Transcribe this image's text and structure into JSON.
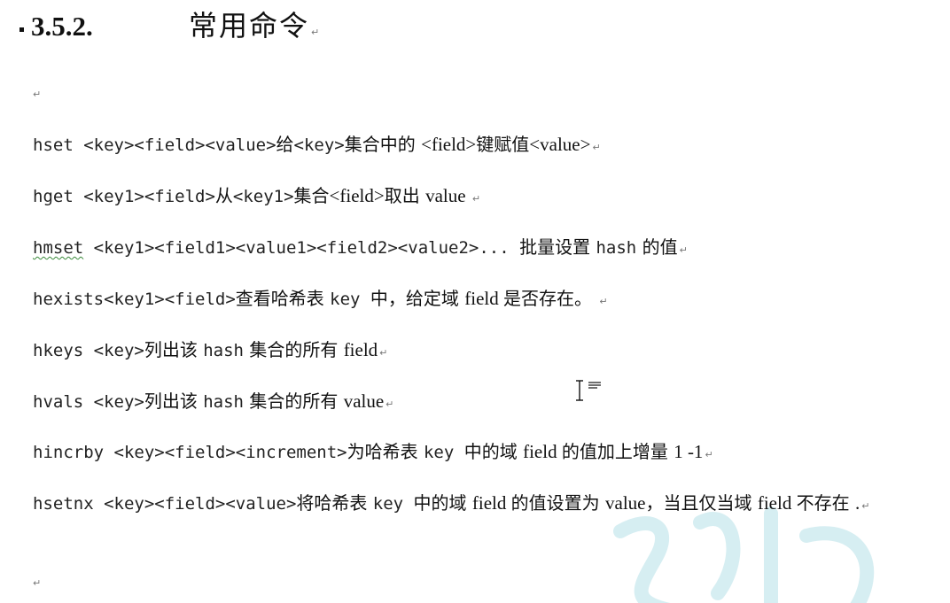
{
  "heading": {
    "number": "3.5.2.",
    "title": "常用命令"
  },
  "paragraph_mark": "↵",
  "commands": [
    {
      "id": "hset",
      "parts": [
        {
          "t": "hset <key><field><value>",
          "s": "mono"
        },
        {
          "t": "给",
          "s": "cjk"
        },
        {
          "t": "<key>",
          "s": "mono"
        },
        {
          "t": "集合中的 ",
          "s": "cjk"
        },
        {
          "t": "  <field>",
          "s": "serif"
        },
        {
          "t": "键赋值",
          "s": "cjk"
        },
        {
          "t": "<value>",
          "s": "serif"
        }
      ]
    },
    {
      "id": "hget",
      "parts": [
        {
          "t": "hget <key1><field>",
          "s": "mono"
        },
        {
          "t": "从",
          "s": "cjk"
        },
        {
          "t": "<key1>",
          "s": "mono"
        },
        {
          "t": "集合",
          "s": "cjk"
        },
        {
          "t": "<field>",
          "s": "serif"
        },
        {
          "t": "取出 ",
          "s": "cjk"
        },
        {
          "t": " value ",
          "s": "serif"
        }
      ]
    },
    {
      "id": "hmset",
      "parts": [
        {
          "t": "hmset",
          "s": "mono squiggle"
        },
        {
          "t": " <key1><field1><value1><field2><value2>... ",
          "s": "mono"
        },
        {
          "t": "批量设置 ",
          "s": "cjk"
        },
        {
          "t": "hash",
          "s": "mono"
        },
        {
          "t": " 的值",
          "s": "cjk"
        }
      ]
    },
    {
      "id": "hexists",
      "parts": [
        {
          "t": "hexists<key1><field>",
          "s": "mono"
        },
        {
          "t": "查看哈希表 ",
          "s": "cjk"
        },
        {
          "t": " key ",
          "s": "mono"
        },
        {
          "t": "中，给定域 ",
          "s": "cjk"
        },
        {
          "t": " field ",
          "s": "serif"
        },
        {
          "t": "是否存在。 ",
          "s": "cjk"
        }
      ]
    },
    {
      "id": "hkeys",
      "parts": [
        {
          "t": "hkeys <key>",
          "s": "mono"
        },
        {
          "t": "列出该 ",
          "s": "cjk"
        },
        {
          "t": "hash",
          "s": "mono"
        },
        {
          "t": " 集合的所有 ",
          "s": "cjk"
        },
        {
          "t": "field",
          "s": "serif"
        }
      ]
    },
    {
      "id": "hvals",
      "parts": [
        {
          "t": "hvals <key>",
          "s": "mono"
        },
        {
          "t": "列出该 ",
          "s": "cjk"
        },
        {
          "t": "hash",
          "s": "mono"
        },
        {
          "t": " 集合的所有 ",
          "s": "cjk"
        },
        {
          "t": "value",
          "s": "serif"
        }
      ]
    },
    {
      "id": "hincrby",
      "parts": [
        {
          "t": "hincrby <key><field><increment>",
          "s": "mono"
        },
        {
          "t": "为哈希表 ",
          "s": "cjk"
        },
        {
          "t": " key ",
          "s": "mono"
        },
        {
          "t": "中的域 ",
          "s": "cjk"
        },
        {
          "t": " field ",
          "s": "serif"
        },
        {
          "t": "的值加上增量 ",
          "s": "cjk"
        },
        {
          "t": " 1  -1",
          "s": "serif"
        }
      ]
    },
    {
      "id": "hsetnx",
      "parts": [
        {
          "t": "hsetnx <key><field><value>",
          "s": "mono"
        },
        {
          "t": "将哈希表 ",
          "s": "cjk"
        },
        {
          "t": " key ",
          "s": "mono"
        },
        {
          "t": "中的域 ",
          "s": "cjk"
        },
        {
          "t": " field ",
          "s": "serif"
        },
        {
          "t": "的值设置为 ",
          "s": "cjk"
        },
        {
          "t": " value",
          "s": "serif"
        },
        {
          "t": "，当且仅当域 ",
          "s": "cjk"
        },
        {
          "t": "field ",
          "s": "serif"
        },
        {
          "t": "不存在 ",
          "s": "cjk"
        },
        {
          "t": " .",
          "s": "serif"
        }
      ]
    }
  ],
  "colors": {
    "text": "#111111",
    "paragraph_mark": "#777777",
    "spell_underline": "#3a8a3a",
    "watermark": "#d6eef2"
  },
  "icons": {
    "paragraph_mark": "return-arrow-icon",
    "cursor": "text-ibeam-cursor-icon",
    "watermark": "watermark-logo"
  }
}
